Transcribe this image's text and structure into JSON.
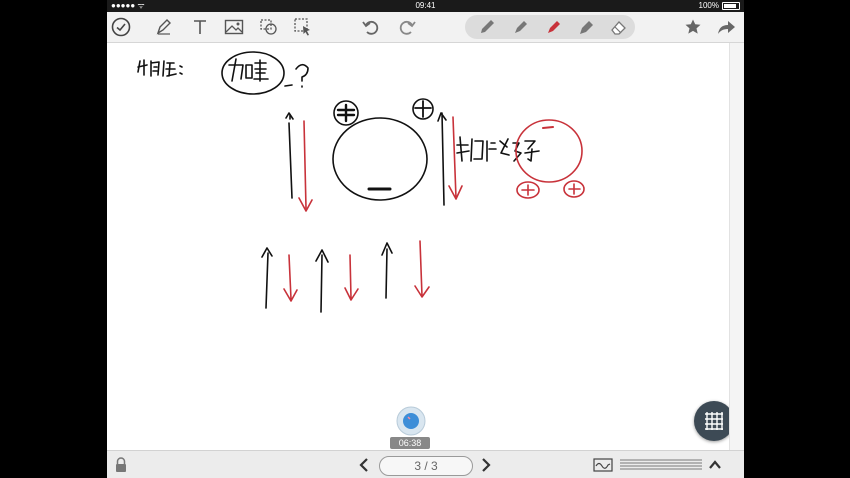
{
  "status_bar": {
    "signal": "●●●●● ᯤ",
    "time": "09:41",
    "battery_text": "100%",
    "battery_level": 1.0
  },
  "toolbar": {
    "left_tools": [
      "checkmark-icon",
      "pen-icon",
      "text-icon",
      "image-icon",
      "shapes-icon",
      "select-icon"
    ],
    "history": [
      "undo-icon",
      "redo-icon"
    ],
    "pens": [
      "pencil-gray",
      "pen-gray",
      "pen-red",
      "marker-gray",
      "eraser"
    ],
    "active_pen": "pen-red",
    "right_tools": [
      "star-icon",
      "share-icon"
    ]
  },
  "colors": {
    "ink": "#111111",
    "red_ink": "#c8323a",
    "toolbar_bg": "#f2f2f2"
  },
  "recording": {
    "time": "06:38"
  },
  "pagination": {
    "indicator": "3 / 3",
    "current": 3,
    "total": 3
  }
}
